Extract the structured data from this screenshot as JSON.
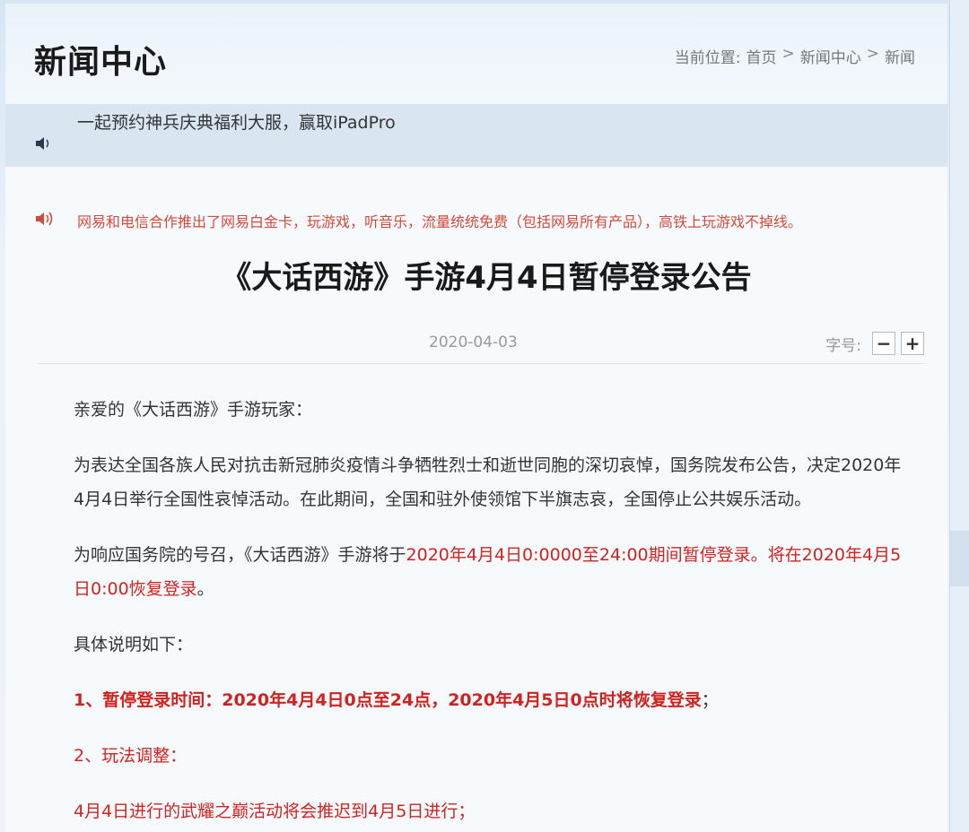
{
  "header": {
    "section_title": "新闻中心",
    "breadcrumb": {
      "prefix": "当前位置:",
      "items": [
        "首页",
        "新闻中心",
        "新闻"
      ],
      "separator": ">"
    }
  },
  "ticker_top": {
    "icon": "speaker-icon",
    "text": "一起预约神兵庆典福利大服，赢取iPadPro"
  },
  "ticker_notice": {
    "icon": "speaker-icon",
    "text": "网易和电信合作推出了网易白金卡，玩游戏，听音乐，流量统统免费（包括网易所有产品），高铁上玩游戏不掉线。"
  },
  "article": {
    "title": "《大话西游》手游4月4日暂停登录公告",
    "date": "2020-04-03",
    "font_size_label": "字号:",
    "font_decrease": "−",
    "font_increase": "+",
    "greeting": "亲爱的《大话西游》手游玩家：",
    "para1": "为表达全国各族人民对抗击新冠肺炎疫情斗争牺牲烈士和逝世同胞的深切哀悼，国务院发布公告，决定2020年4月4日举行全国性哀悼活动。在此期间，全国和驻外使领馆下半旗志哀，全国停止公共娱乐活动。",
    "para2_normal": "为响应国务院的号召，《大话西游》手游将于",
    "para2_red": "2020年4月4日0:0000至24:00期间暂停登录。将在2020年4月5日0:00恢复登录",
    "para2_end": "。",
    "para3": "具体说明如下：",
    "item1_red": "1、暂停登录时间：2020年4月4日0点至24点，2020年4月5日0点时将恢复登录",
    "item1_end": "；",
    "item2": "2、玩法调整：",
    "item3": "4月4日进行的武耀之巅活动将会推迟到4月5日进行；"
  },
  "colors": {
    "accent_red": "#d0231f",
    "notice_red": "#d24a3a",
    "text": "#333333",
    "header_bg": "#eaf2fa"
  }
}
